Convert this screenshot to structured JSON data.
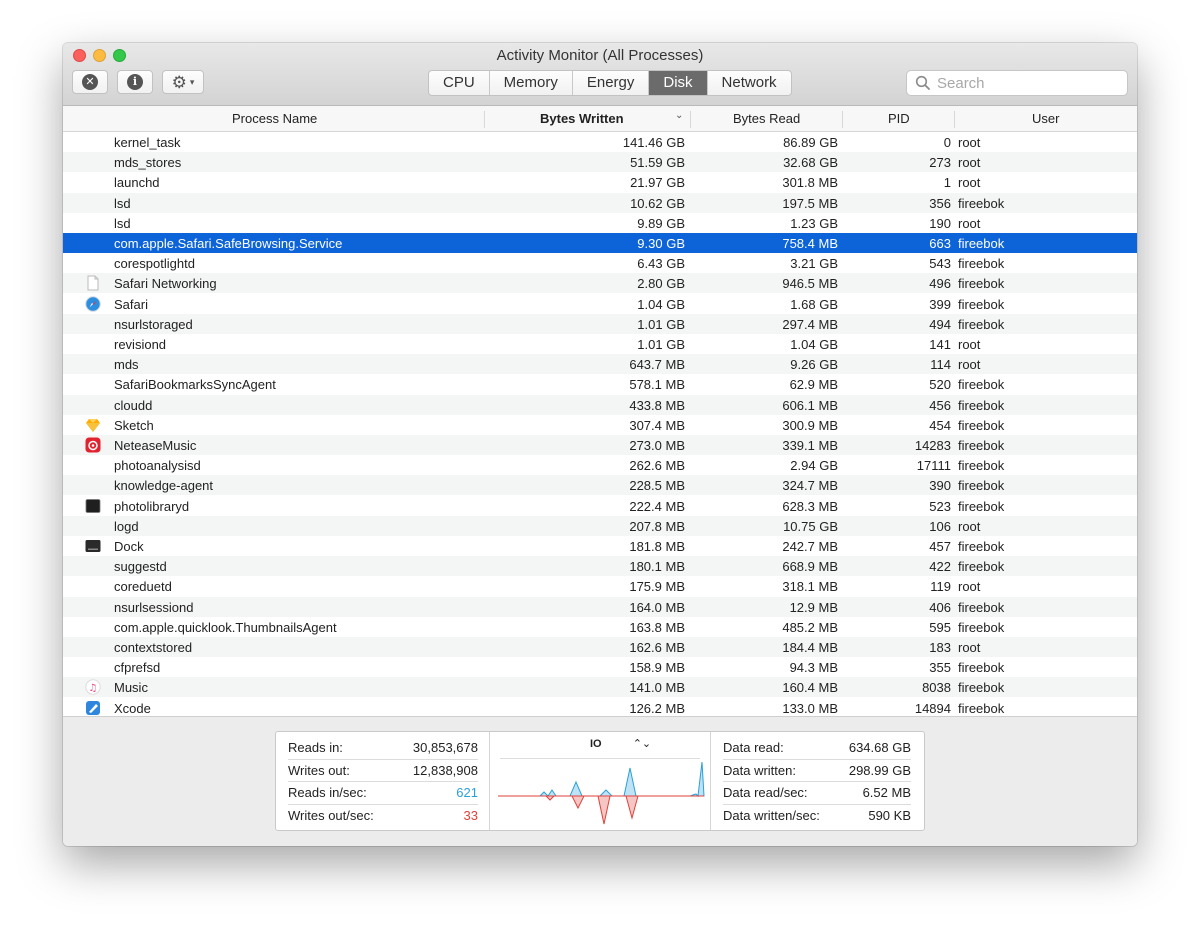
{
  "window": {
    "title": "Activity Monitor (All Processes)"
  },
  "toolbar": {
    "stop_icon": "x-circle-icon",
    "info_icon": "info-icon",
    "gear_icon": "gear-icon",
    "tabs": [
      {
        "label": "CPU",
        "active": false
      },
      {
        "label": "Memory",
        "active": false
      },
      {
        "label": "Energy",
        "active": false
      },
      {
        "label": "Disk",
        "active": true
      },
      {
        "label": "Network",
        "active": false
      }
    ],
    "search": {
      "placeholder": "Search",
      "value": ""
    }
  },
  "columns": {
    "name": "Process Name",
    "bytes_written": "Bytes Written",
    "bytes_read": "Bytes Read",
    "pid": "PID",
    "user": "User",
    "sorted_by": "Bytes Written"
  },
  "processes": [
    {
      "name": "kernel_task",
      "bw": "141.46 GB",
      "br": "86.89 GB",
      "pid": "0",
      "user": "root",
      "icon": ""
    },
    {
      "name": "mds_stores",
      "bw": "51.59 GB",
      "br": "32.68 GB",
      "pid": "273",
      "user": "root",
      "icon": ""
    },
    {
      "name": "launchd",
      "bw": "21.97 GB",
      "br": "301.8 MB",
      "pid": "1",
      "user": "root",
      "icon": ""
    },
    {
      "name": "lsd",
      "bw": "10.62 GB",
      "br": "197.5 MB",
      "pid": "356",
      "user": "fireebok",
      "icon": ""
    },
    {
      "name": "lsd",
      "bw": "9.89 GB",
      "br": "1.23 GB",
      "pid": "190",
      "user": "root",
      "icon": ""
    },
    {
      "name": "com.apple.Safari.SafeBrowsing.Service",
      "bw": "9.30 GB",
      "br": "758.4 MB",
      "pid": "663",
      "user": "fireebok",
      "icon": "",
      "selected": true
    },
    {
      "name": "corespotlightd",
      "bw": "6.43 GB",
      "br": "3.21 GB",
      "pid": "543",
      "user": "fireebok",
      "icon": ""
    },
    {
      "name": "Safari Networking",
      "bw": "2.80 GB",
      "br": "946.5 MB",
      "pid": "496",
      "user": "fireebok",
      "icon": "document-icon"
    },
    {
      "name": "Safari",
      "bw": "1.04 GB",
      "br": "1.68 GB",
      "pid": "399",
      "user": "fireebok",
      "icon": "safari-icon"
    },
    {
      "name": "nsurlstoraged",
      "bw": "1.01 GB",
      "br": "297.4 MB",
      "pid": "494",
      "user": "fireebok",
      "icon": ""
    },
    {
      "name": "revisiond",
      "bw": "1.01 GB",
      "br": "1.04 GB",
      "pid": "141",
      "user": "root",
      "icon": ""
    },
    {
      "name": "mds",
      "bw": "643.7 MB",
      "br": "9.26 GB",
      "pid": "114",
      "user": "root",
      "icon": ""
    },
    {
      "name": "SafariBookmarksSyncAgent",
      "bw": "578.1 MB",
      "br": "62.9 MB",
      "pid": "520",
      "user": "fireebok",
      "icon": ""
    },
    {
      "name": "cloudd",
      "bw": "433.8 MB",
      "br": "606.1 MB",
      "pid": "456",
      "user": "fireebok",
      "icon": ""
    },
    {
      "name": "Sketch",
      "bw": "307.4 MB",
      "br": "300.9 MB",
      "pid": "454",
      "user": "fireebok",
      "icon": "sketch-icon"
    },
    {
      "name": "NeteaseMusic",
      "bw": "273.0 MB",
      "br": "339.1 MB",
      "pid": "14283",
      "user": "fireebok",
      "icon": "netease-music-icon"
    },
    {
      "name": "photoanalysisd",
      "bw": "262.6 MB",
      "br": "2.94 GB",
      "pid": "17111",
      "user": "fireebok",
      "icon": ""
    },
    {
      "name": "knowledge-agent",
      "bw": "228.5 MB",
      "br": "324.7 MB",
      "pid": "390",
      "user": "fireebok",
      "icon": ""
    },
    {
      "name": "photolibraryd",
      "bw": "222.4 MB",
      "br": "628.3 MB",
      "pid": "523",
      "user": "fireebok",
      "icon": "terminal-icon"
    },
    {
      "name": "logd",
      "bw": "207.8 MB",
      "br": "10.75 GB",
      "pid": "106",
      "user": "root",
      "icon": ""
    },
    {
      "name": "Dock",
      "bw": "181.8 MB",
      "br": "242.7 MB",
      "pid": "457",
      "user": "fireebok",
      "icon": "dock-icon"
    },
    {
      "name": "suggestd",
      "bw": "180.1 MB",
      "br": "668.9 MB",
      "pid": "422",
      "user": "fireebok",
      "icon": ""
    },
    {
      "name": "coreduetd",
      "bw": "175.9 MB",
      "br": "318.1 MB",
      "pid": "119",
      "user": "root",
      "icon": ""
    },
    {
      "name": "nsurlsessiond",
      "bw": "164.0 MB",
      "br": "12.9 MB",
      "pid": "406",
      "user": "fireebok",
      "icon": ""
    },
    {
      "name": "com.apple.quicklook.ThumbnailsAgent",
      "bw": "163.8 MB",
      "br": "485.2 MB",
      "pid": "595",
      "user": "fireebok",
      "icon": ""
    },
    {
      "name": "contextstored",
      "bw": "162.6 MB",
      "br": "184.4 MB",
      "pid": "183",
      "user": "root",
      "icon": ""
    },
    {
      "name": "cfprefsd",
      "bw": "158.9 MB",
      "br": "94.3 MB",
      "pid": "355",
      "user": "fireebok",
      "icon": ""
    },
    {
      "name": "Music",
      "bw": "141.0 MB",
      "br": "160.4 MB",
      "pid": "8038",
      "user": "fireebok",
      "icon": "music-icon"
    },
    {
      "name": "Xcode",
      "bw": "126.2 MB",
      "br": "133.0 MB",
      "pid": "14894",
      "user": "fireebok",
      "icon": "xcode-icon"
    }
  ],
  "footer": {
    "left": [
      {
        "label": "Reads in:",
        "value": "30,853,678"
      },
      {
        "label": "Writes out:",
        "value": "12,838,908"
      },
      {
        "label": "Reads in/sec:",
        "value": "621"
      },
      {
        "label": "Writes out/sec:",
        "value": "33"
      }
    ],
    "graph_label": "IO",
    "right": [
      {
        "label": "Data read:",
        "value": "634.68 GB"
      },
      {
        "label": "Data written:",
        "value": "298.99 GB"
      },
      {
        "label": "Data read/sec:",
        "value": "6.52 MB"
      },
      {
        "label": "Data written/sec:",
        "value": "590 KB"
      }
    ],
    "colors": {
      "reads": "#2aa0d8",
      "writes": "#e0413a"
    }
  }
}
